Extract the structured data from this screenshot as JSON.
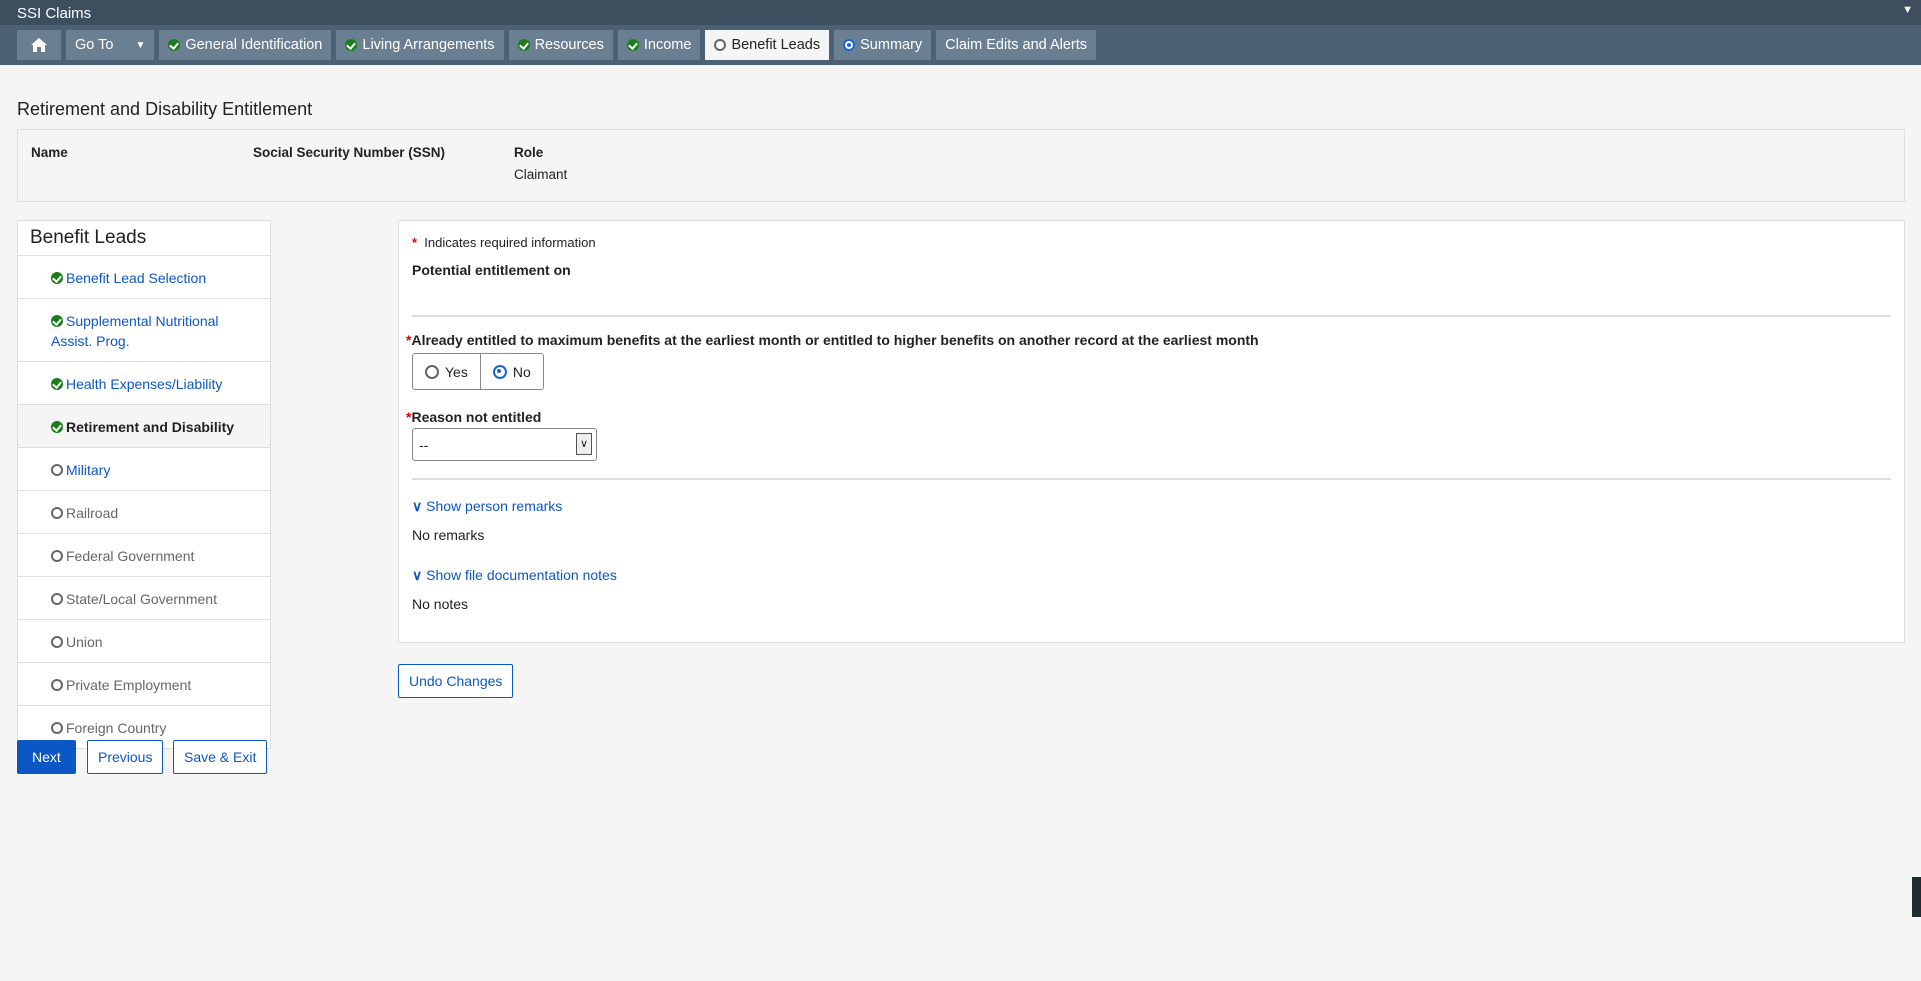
{
  "app_title": "SSI Claims",
  "nav": {
    "goto": "Go To",
    "tabs": [
      {
        "label": "General Identification",
        "status": "complete"
      },
      {
        "label": "Living Arrangements",
        "status": "complete"
      },
      {
        "label": "Resources",
        "status": "complete"
      },
      {
        "label": "Income",
        "status": "complete"
      },
      {
        "label": "Benefit Leads",
        "status": "active"
      },
      {
        "label": "Summary",
        "status": "current"
      },
      {
        "label": "Claim Edits and Alerts",
        "status": "none"
      }
    ]
  },
  "page_title": "Retirement and Disability Entitlement",
  "info": {
    "name_label": "Name",
    "ssn_label": "Social Security Number (SSN)",
    "role_label": "Role",
    "role_value": "Claimant"
  },
  "sidebar": {
    "title": "Benefit Leads",
    "items": [
      {
        "label": "Benefit Lead Selection",
        "status": "complete"
      },
      {
        "label": "Supplemental Nutritional Assist. Prog.",
        "status": "complete"
      },
      {
        "label": "Health Expenses/Liability",
        "status": "complete"
      },
      {
        "label": "Retirement and Disability",
        "status": "selected"
      },
      {
        "label": "Military",
        "status": "open"
      },
      {
        "label": "Railroad",
        "status": "open"
      },
      {
        "label": "Federal Government",
        "status": "open"
      },
      {
        "label": "State/Local Government",
        "status": "open"
      },
      {
        "label": "Union",
        "status": "open"
      },
      {
        "label": "Private Employment",
        "status": "open"
      },
      {
        "label": "Foreign Country",
        "status": "open"
      }
    ]
  },
  "form": {
    "required_note": "Indicates required information",
    "potential_label": "Potential entitlement on",
    "q1": "Already entitled to maximum benefits at the earliest month or entitled to higher benefits on another record at the earliest month",
    "yes": "Yes",
    "no": "No",
    "selected": "No",
    "reason_label": "Reason not entitled",
    "reason_value": "--",
    "show_remarks": "Show person remarks",
    "no_remarks": "No remarks",
    "show_notes": "Show file documentation notes",
    "no_notes": "No notes"
  },
  "buttons": {
    "undo": "Undo Changes",
    "next": "Next",
    "previous": "Previous",
    "save_exit": "Save & Exit"
  }
}
